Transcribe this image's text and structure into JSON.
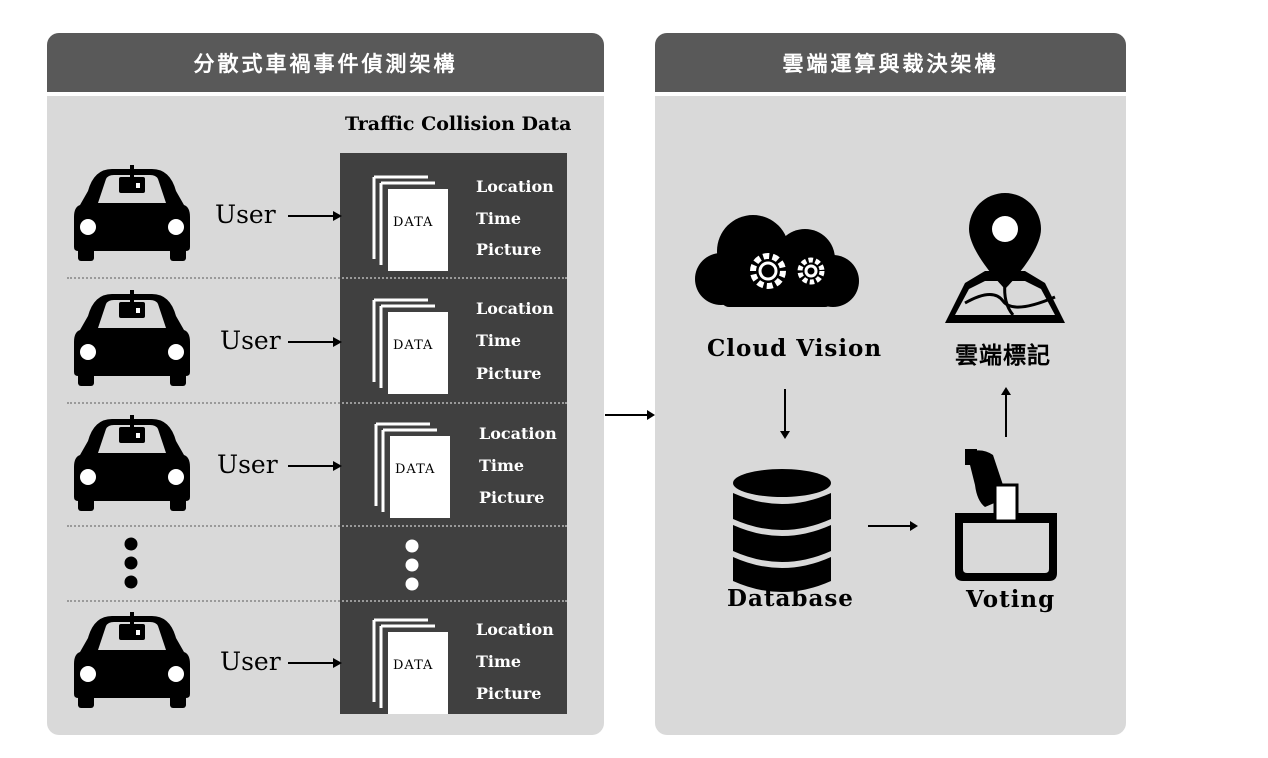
{
  "left_panel": {
    "title": "分散式車禍事件偵測架構",
    "collision_data_title": "Traffic Collision Data",
    "rows": [
      {
        "user": "User",
        "doc": "DATA",
        "fields": [
          "Location",
          "Time",
          "Picture"
        ]
      },
      {
        "user": "User",
        "doc": "DATA",
        "fields": [
          "Location",
          "Time",
          "Picture"
        ]
      },
      {
        "user": "User",
        "doc": "DATA",
        "fields": [
          "Location",
          "Time",
          "Picture"
        ]
      },
      {
        "user": "User",
        "doc": "DATA",
        "fields": [
          "Location",
          "Time",
          "Picture"
        ]
      }
    ]
  },
  "right_panel": {
    "title": "雲端運算與裁決架構",
    "cloud_vision_label": "Cloud Vision",
    "cloud_mark_label": "雲端標記",
    "database_label": "Database",
    "voting_label": "Voting"
  },
  "icons": [
    "car-icon",
    "document-stack-icon",
    "cloud-gears-icon",
    "map-pin-icon",
    "database-icon",
    "ballot-box-icon",
    "arrow-right-icon",
    "arrow-down-icon",
    "arrow-up-icon"
  ],
  "colors": {
    "header": "#595959",
    "panel": "#d9d9d9",
    "data_column": "#404040"
  }
}
